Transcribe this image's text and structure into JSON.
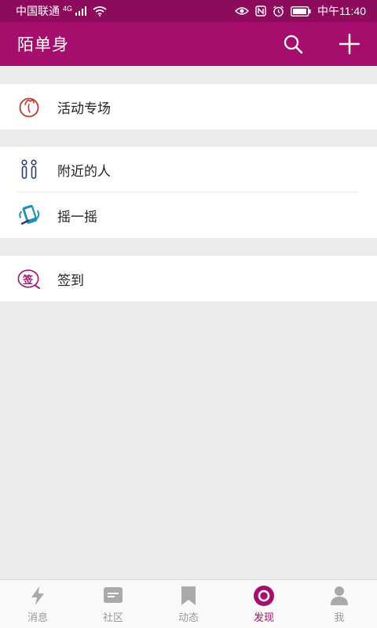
{
  "status_bar": {
    "carrier": "中国联通",
    "network": "4G",
    "time": "中午11:40",
    "icons": [
      "signal-icon",
      "wifi-icon",
      "eye-icon",
      "nfc-icon",
      "alarm-icon",
      "battery-icon"
    ]
  },
  "header": {
    "title": "陌单身",
    "actions": [
      "search-icon",
      "plus-icon"
    ]
  },
  "groups": [
    {
      "items": [
        {
          "label": "活动专场",
          "icon": "activity-icon"
        }
      ]
    },
    {
      "items": [
        {
          "label": "附近的人",
          "icon": "nearby-people-icon"
        },
        {
          "label": "摇一摇",
          "icon": "shake-icon"
        }
      ]
    },
    {
      "items": [
        {
          "label": "签到",
          "icon": "checkin-icon",
          "icon_text": "签"
        }
      ]
    }
  ],
  "tab_bar": {
    "tabs": [
      {
        "label": "消息",
        "icon": "lightning-icon",
        "active": false
      },
      {
        "label": "社区",
        "icon": "community-icon",
        "active": false
      },
      {
        "label": "动态",
        "icon": "bookmark-icon",
        "active": false
      },
      {
        "label": "发现",
        "icon": "discover-icon",
        "active": true
      },
      {
        "label": "我",
        "icon": "person-icon",
        "active": false
      }
    ]
  },
  "colors": {
    "status_bar": "#8c0b5c",
    "app_bar": "#a50e6c",
    "accent": "#a50e6c",
    "background": "#ebebeb",
    "tab_inactive": "#999999"
  }
}
